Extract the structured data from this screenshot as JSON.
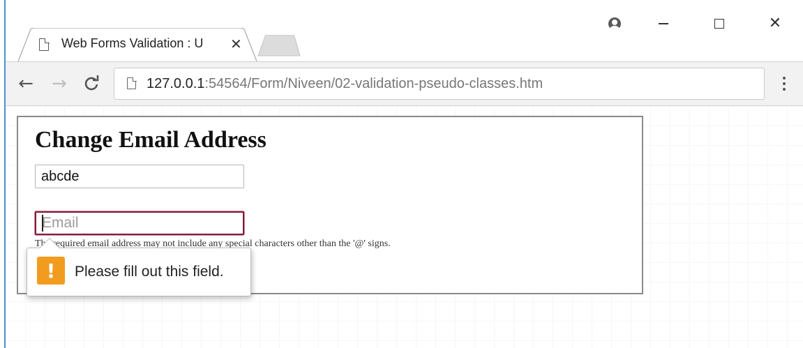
{
  "browser": {
    "tab": {
      "title": "Web Forms Validation : U",
      "close_glyph": "✕"
    },
    "window_controls": {
      "close_glyph": "✕"
    },
    "toolbar": {
      "back_glyph": "←",
      "forward_glyph": "→",
      "reload_glyph": "C",
      "url_host": "127.0.0.1",
      "url_rest": ":54564/Form/Niveen/02-validation-pseudo-classes.htm"
    },
    "icons": [
      "profile-icon",
      "minimize-icon",
      "maximize-icon",
      "close-icon",
      "document-icon",
      "back-arrow-icon",
      "forward-arrow-icon",
      "reload-icon",
      "page-info-icon",
      "menu-icon",
      "warning-icon"
    ]
  },
  "form": {
    "heading": "Change Email Address",
    "text_input_value": "abcde",
    "email_placeholder": "Email",
    "help_text": "The required email address may not include any special characters other than the '@' signs."
  },
  "validation": {
    "icon_glyph": "!",
    "message": "Please fill out this field."
  },
  "colors": {
    "invalid_border": "#7d1e3a",
    "warning_icon": "#f29c1f",
    "accent_edge": "#4a90d9"
  }
}
